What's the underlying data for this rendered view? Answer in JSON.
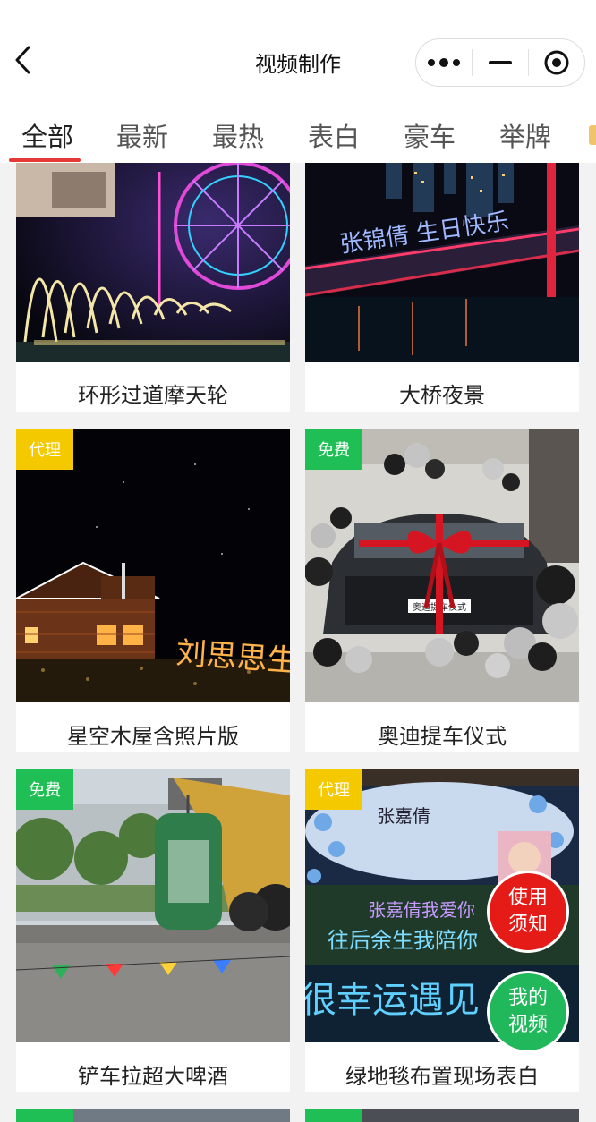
{
  "header": {
    "title": "视频制作"
  },
  "tabs": [
    {
      "label": "全部",
      "active": true
    },
    {
      "label": "最新",
      "active": false
    },
    {
      "label": "最热",
      "active": false
    },
    {
      "label": "表白",
      "active": false
    },
    {
      "label": "豪车",
      "active": false
    },
    {
      "label": "举牌",
      "active": false
    }
  ],
  "cards": [
    {
      "caption": "环形过道摩天轮",
      "badge": ""
    },
    {
      "caption": "大桥夜景",
      "badge": ""
    },
    {
      "caption": "星空木屋含照片版",
      "badge": "代理"
    },
    {
      "caption": "奥迪提车仪式",
      "badge": "免费"
    },
    {
      "caption": "铲车拉超大啤酒",
      "badge": "免费"
    },
    {
      "caption": "绿地毯布置现场表白",
      "badge": "代理"
    }
  ],
  "thumb_text": {
    "bridge_name": "张锦倩 生日快乐",
    "cabin_name": "刘思思生",
    "car_plate": "奥迪提车仪式",
    "lawn_line1": "张嘉倩我爱你",
    "lawn_line2": "往后余生我陪你",
    "lawn_line3": "很幸运遇见",
    "lawn_board": "张嘉倩"
  },
  "floating": {
    "notice_line1": "使用",
    "notice_line2": "须知",
    "myvideo_line1": "我的",
    "myvideo_line2": "视频"
  },
  "colors": {
    "tab_indicator": "#e53935",
    "badge_agent": "#f5c900",
    "badge_free": "#1fbf55",
    "notice_button": "#e41b17",
    "myvideo_button": "#20b85a"
  }
}
